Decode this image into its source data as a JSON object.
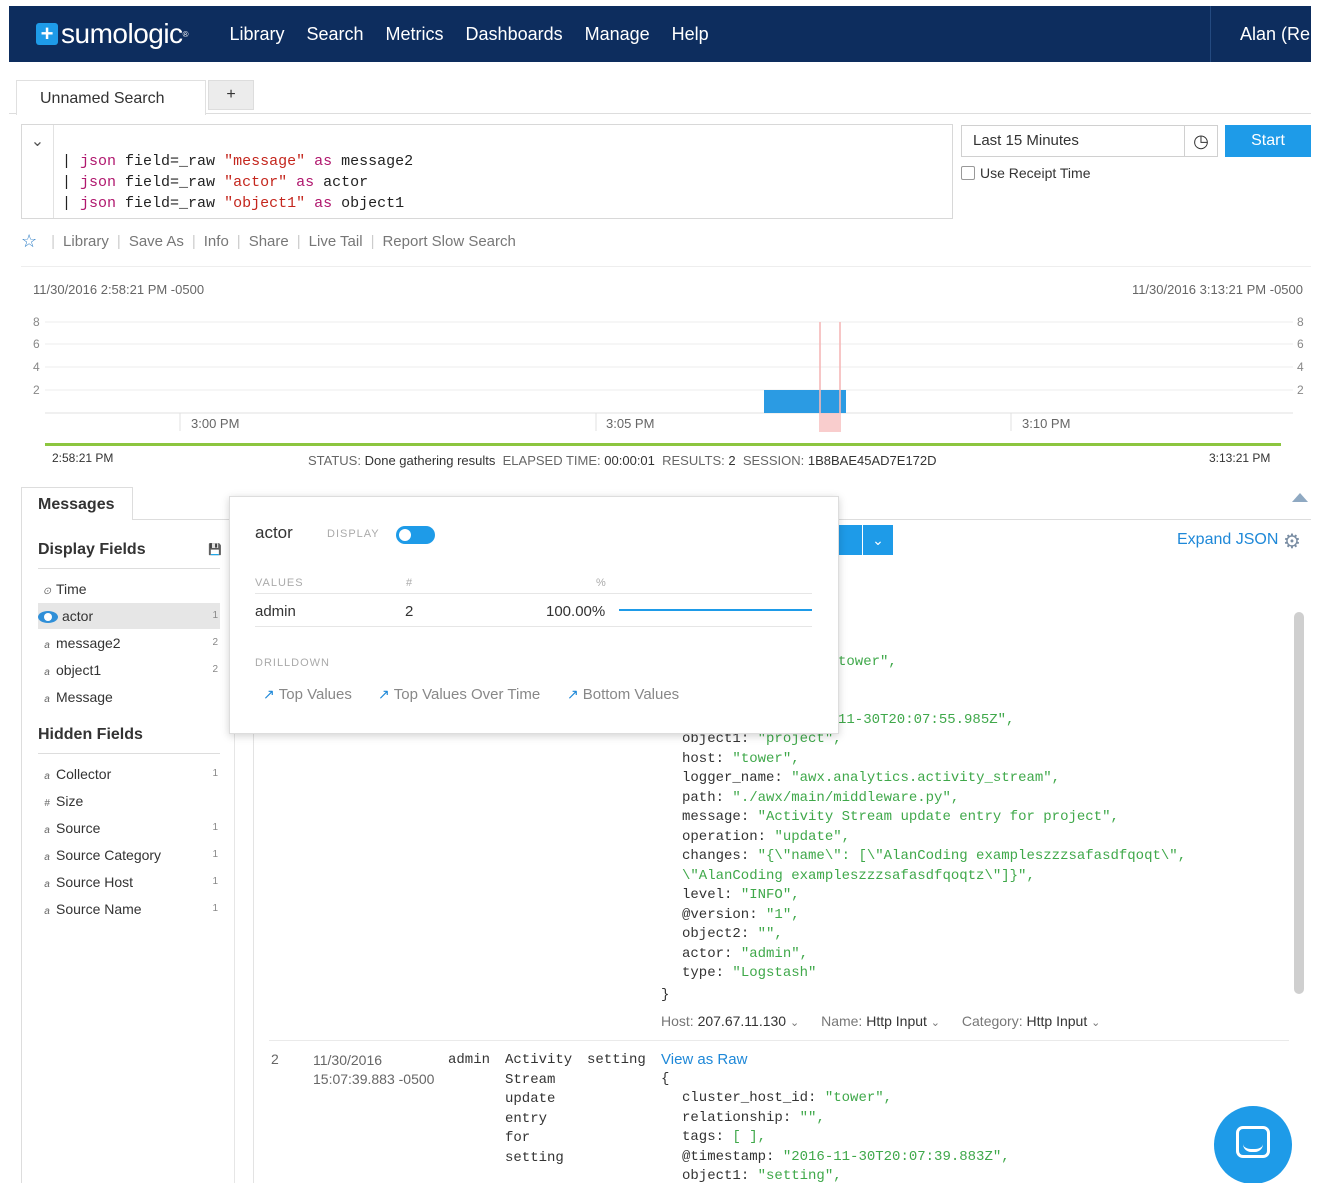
{
  "nav": {
    "logo_text": "sumologic",
    "logo_reg": "®",
    "logo_plus": "+",
    "links": [
      "Library",
      "Search",
      "Metrics",
      "Dashboards",
      "Manage",
      "Help"
    ],
    "user": "Alan (Re"
  },
  "tabs": {
    "active_label": "Unnamed Search",
    "add_label": "+"
  },
  "query": {
    "toggle_icon": "chevron-down-icon",
    "lines": [
      {
        "pipe": "| ",
        "cmd": "json",
        "arg": " field=_raw ",
        "str": "\"message\"",
        "as": " as ",
        "alias": "message2"
      },
      {
        "pipe": "| ",
        "cmd": "json",
        "arg": " field=_raw ",
        "str": "\"actor\"",
        "as": " as ",
        "alias": "actor"
      },
      {
        "pipe": "| ",
        "cmd": "json",
        "arg": " field=_raw ",
        "str": "\"object1\"",
        "as": " as ",
        "alias": "object1"
      }
    ]
  },
  "time": {
    "range": "Last 15 Minutes",
    "start_label": "Start",
    "receipt_label": "Use Receipt Time",
    "receipt_checked": false
  },
  "actions": [
    "Library",
    "Save As",
    "Info",
    "Share",
    "Live Tail",
    "Report Slow Search"
  ],
  "histogram": {
    "range_start": "11/30/2016 2:58:21 PM -0500",
    "range_end": "11/30/2016 3:13:21 PM -0500",
    "y_ticks": [
      "8",
      "6",
      "4",
      "2"
    ],
    "y_ticks_right": [
      "8",
      "6",
      "4",
      "2"
    ],
    "x_ticks": [
      "3:00 PM",
      "3:05 PM",
      "3:10 PM"
    ],
    "start_time": "2:58:21 PM",
    "end_time": "3:13:21 PM",
    "bar_value": 2,
    "colors": {
      "bar": "#2b9be3",
      "marker": "#f6b8b8",
      "progress": "#8cc63f"
    }
  },
  "status": {
    "status_label": "STATUS:",
    "status_value": "Done gathering results",
    "elapsed_label": "ELAPSED TIME:",
    "elapsed_value": "00:00:01",
    "results_label": "RESULTS:",
    "results_value": "2",
    "session_label": "SESSION:",
    "session_value": "1B8BAE45AD7E172D"
  },
  "messages": {
    "tab_label": "Messages",
    "expand_json": "Expand JSON",
    "display_fields_title": "Display Fields",
    "hidden_fields_title": "Hidden Fields",
    "display_fields": [
      {
        "icon": "clock",
        "glyph": "⊙",
        "name": "Time",
        "count": ""
      },
      {
        "icon": "eye",
        "glyph": "",
        "name": "actor",
        "count": "1"
      },
      {
        "icon": "text",
        "glyph": "a",
        "name": "message2",
        "count": "2"
      },
      {
        "icon": "text",
        "glyph": "a",
        "name": "object1",
        "count": "2"
      },
      {
        "icon": "text",
        "glyph": "a",
        "name": "Message",
        "count": ""
      }
    ],
    "hidden_fields": [
      {
        "glyph": "a",
        "name": "Collector",
        "count": "1"
      },
      {
        "glyph": "#",
        "name": "Size",
        "count": ""
      },
      {
        "glyph": "a",
        "name": "Source",
        "count": "1"
      },
      {
        "glyph": "a",
        "name": "Source Category",
        "count": "1"
      },
      {
        "glyph": "a",
        "name": "Source Host",
        "count": "1"
      },
      {
        "glyph": "a",
        "name": "Source Name",
        "count": "1"
      }
    ]
  },
  "popup": {
    "title": "actor",
    "display_label": "DISPLAY",
    "display_on": true,
    "col_values": "VALUES",
    "col_count": "#",
    "col_pct": "%",
    "value": "admin",
    "count": "2",
    "pct": "100.00%",
    "pct_fraction": 1.0,
    "drilldown_label": "DRILLDOWN",
    "links": [
      "Top Values",
      "Top Values Over Time",
      "Bottom Values"
    ]
  },
  "record1": {
    "partial_line1": "tower\",",
    "partial_line2": "11-30T20:07:55.985Z\",",
    "pairs": [
      {
        "k": "object1",
        "v": "\"project\","
      },
      {
        "k": "host",
        "v": "\"tower\","
      },
      {
        "k": "logger_name",
        "v": "\"awx.analytics.activity_stream\","
      },
      {
        "k": "path",
        "v": "\"./awx/main/middleware.py\","
      },
      {
        "k": "message",
        "v": "\"Activity Stream update entry for project\","
      },
      {
        "k": "operation",
        "v": "\"update\","
      },
      {
        "k": "changes",
        "v": "\"{\\\"name\\\": [\\\"AlanCoding exampleszzzsafasdfqoqt\\\","
      },
      {
        "k": "",
        "v": "\\\"AlanCoding exampleszzzsafasdfqoqtz\\\"]}\","
      },
      {
        "k": "level",
        "v": "\"INFO\","
      },
      {
        "k": "@version",
        "v": "\"1\","
      },
      {
        "k": "object2",
        "v": "\"\","
      },
      {
        "k": "actor",
        "v": "\"admin\","
      },
      {
        "k": "type",
        "v": "\"Logstash\""
      }
    ],
    "close_brace": "}",
    "meta": {
      "host_label": "Host:",
      "host_value": "207.67.11.130",
      "name_label": "Name:",
      "name_value": "Http Input",
      "cat_label": "Category:",
      "cat_value": "Http Input"
    }
  },
  "record2": {
    "num": "2",
    "date": "11/30/2016",
    "time": "15:07:39.883 -0500",
    "actor": "admin",
    "message_words": [
      "Activity",
      "Stream",
      "update",
      "entry",
      "for",
      "setting"
    ],
    "object1": "setting",
    "view_raw": "View as Raw",
    "open_brace": "{",
    "pairs": [
      {
        "k": "cluster_host_id",
        "v": "\"tower\","
      },
      {
        "k": "relationship",
        "v": "\"\","
      },
      {
        "k": "tags",
        "v": "[ ],"
      },
      {
        "k": "@timestamp",
        "v": "\"2016-11-30T20:07:39.883Z\","
      },
      {
        "k": "object1",
        "v": "\"setting\","
      }
    ]
  }
}
